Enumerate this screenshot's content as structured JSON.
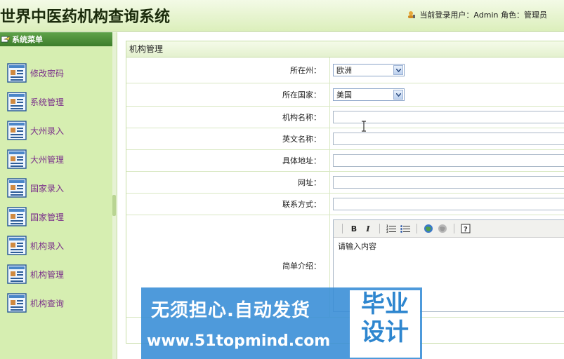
{
  "header": {
    "title": "世界中医药机构查询系统",
    "user_label": "当前登录用户：Admin 角色：管理员"
  },
  "sidebar": {
    "title": "系统菜单",
    "items": [
      {
        "label": "修改密码"
      },
      {
        "label": "系统管理"
      },
      {
        "label": "大州录入"
      },
      {
        "label": "大州管理"
      },
      {
        "label": "国家录入"
      },
      {
        "label": "国家管理"
      },
      {
        "label": "机构录入"
      },
      {
        "label": "机构管理"
      },
      {
        "label": "机构查询"
      }
    ]
  },
  "panel": {
    "title": "机构管理"
  },
  "form": {
    "continent": {
      "label": "所在州：",
      "value": "欧洲"
    },
    "country": {
      "label": "所在国家：",
      "value": "美国"
    },
    "name": {
      "label": "机构名称：",
      "value": ""
    },
    "english_name": {
      "label": "英文名称：",
      "value": ""
    },
    "address": {
      "label": "具体地址：",
      "value": ""
    },
    "website": {
      "label": "网址：",
      "value": ""
    },
    "contact": {
      "label": "联系方式：",
      "value": ""
    },
    "intro": {
      "label": "简单介绍：",
      "content": "请输入内容"
    }
  },
  "editor_toolbar": {
    "bold": "B",
    "italic": "I"
  },
  "watermark": {
    "slogan": "无须担心.自动发货",
    "url": "www.51topmind.com",
    "badge_line1": "毕业",
    "badge_line2": "设计"
  },
  "colors": {
    "header_bg": "#dcefbc",
    "sidebar_bg": "#d6eeb1",
    "sidebar_head": "#3d7d2b",
    "menu_text": "#7a2f8a",
    "watermark_bg": "#368cd6"
  }
}
